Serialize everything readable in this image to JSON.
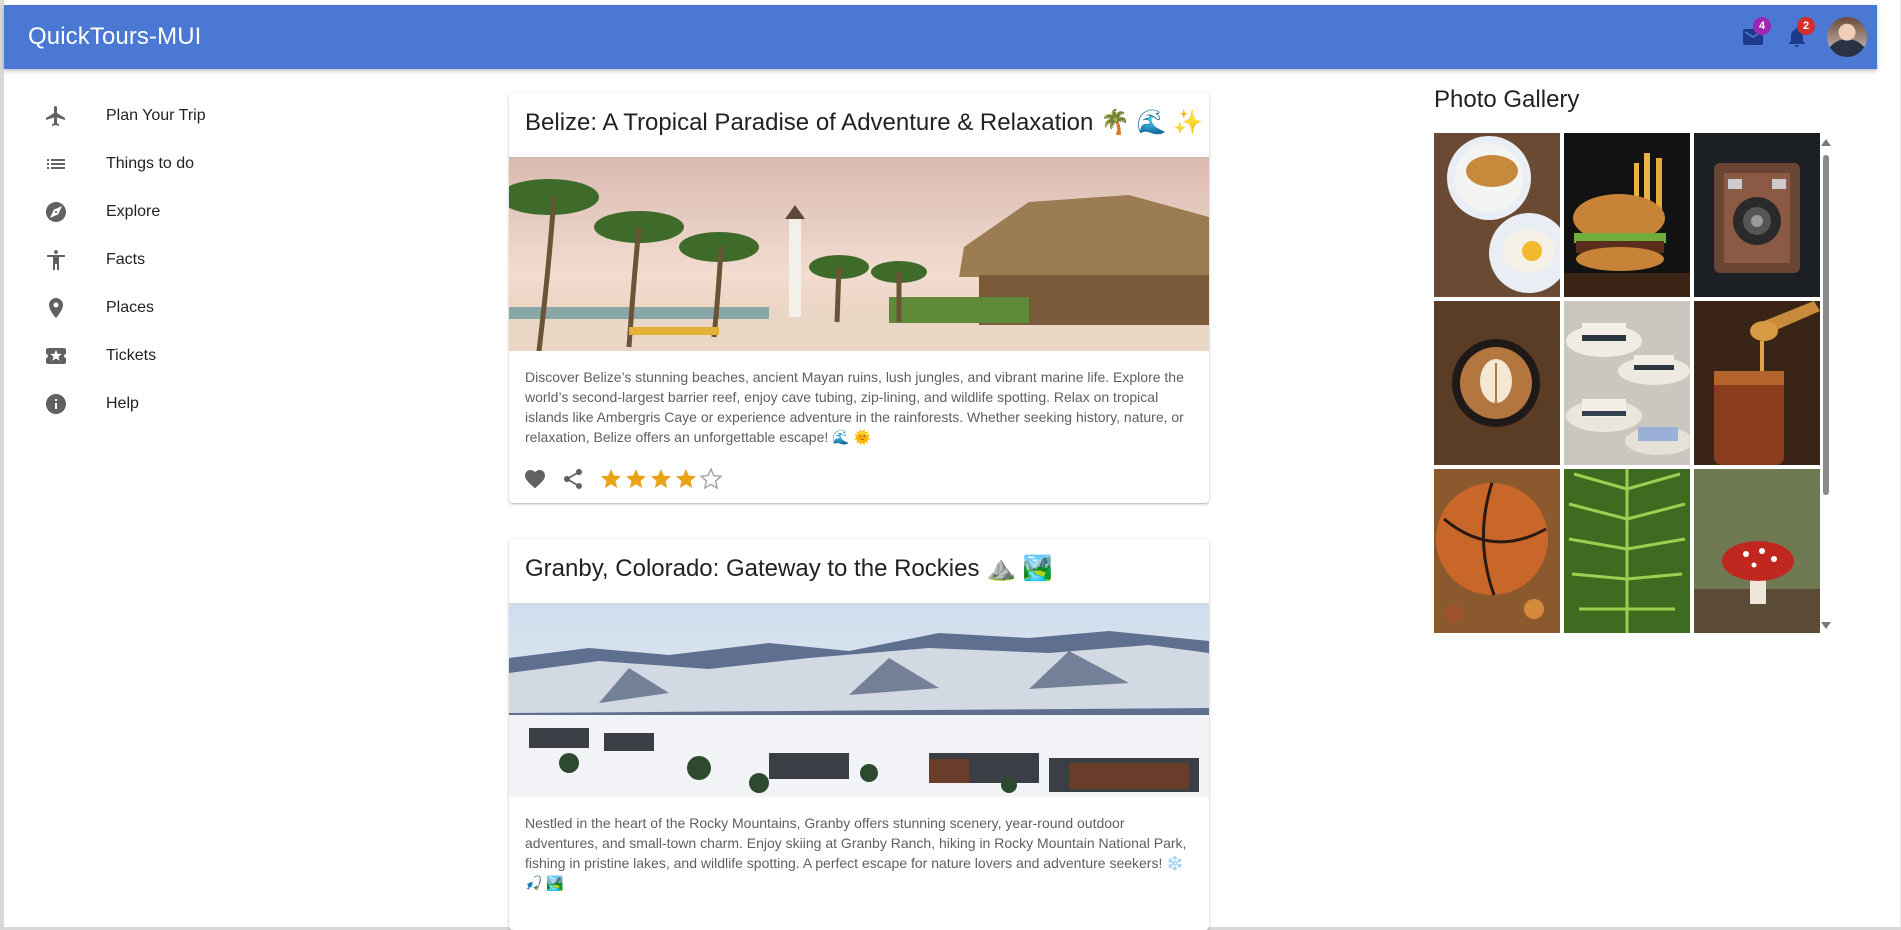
{
  "app": {
    "title": "QuickTours-MUI"
  },
  "header": {
    "mail_badge": "4",
    "notification_badge": "2",
    "mail_badge_color": "#9c27b0",
    "notification_badge_color": "#d32f2f",
    "bar_color": "#4a78d3"
  },
  "sidebar": {
    "items": [
      {
        "label": "Plan Your Trip",
        "icon": "airplane-icon"
      },
      {
        "label": "Things to do",
        "icon": "list-icon"
      },
      {
        "label": "Explore",
        "icon": "compass-icon"
      },
      {
        "label": "Facts",
        "icon": "accessibility-icon"
      },
      {
        "label": "Places",
        "icon": "location-pin-icon"
      },
      {
        "label": "Tickets",
        "icon": "ticket-icon"
      },
      {
        "label": "Help",
        "icon": "info-icon"
      }
    ]
  },
  "cards": [
    {
      "title": "Belize: A Tropical Paradise of Adventure & Relaxation 🌴 🌊 ✨",
      "description": "Discover Belize’s stunning beaches, ancient Mayan ruins, lush jungles, and vibrant marine life. Explore the world’s second-largest barrier reef, enjoy cave tubing, zip-lining, and wildlife spotting. Relax on tropical islands like Ambergris Caye or experience adventure in the rainforests. Whether seeking history, nature, or relaxation, Belize offers an unforgettable escape! 🌊 🌞",
      "rating": 4,
      "rating_max": 5
    },
    {
      "title": "Granby, Colorado: Gateway to the Rockies ⛰️ 🏞️",
      "description": "Nestled in the heart of the Rocky Mountains, Granby offers stunning scenery, year-round outdoor adventures, and small-town charm. Enjoy skiing at Granby Ranch, hiking in Rocky Mountain National Park, fishing in pristine lakes, and wildlife spotting. A perfect escape for nature lovers and adventure seekers! ❄️ 🎣 🏞️"
    }
  ],
  "gallery": {
    "title": "Photo Gallery",
    "photos": [
      "croissant-breakfast",
      "burger-fries",
      "vintage-camera",
      "latte-art",
      "straw-hats",
      "honey-jar",
      "basketball-leaves",
      "fern-leaf",
      "red-mushroom"
    ]
  },
  "colors": {
    "star": "#e8a317",
    "icon_grey": "#616161"
  }
}
